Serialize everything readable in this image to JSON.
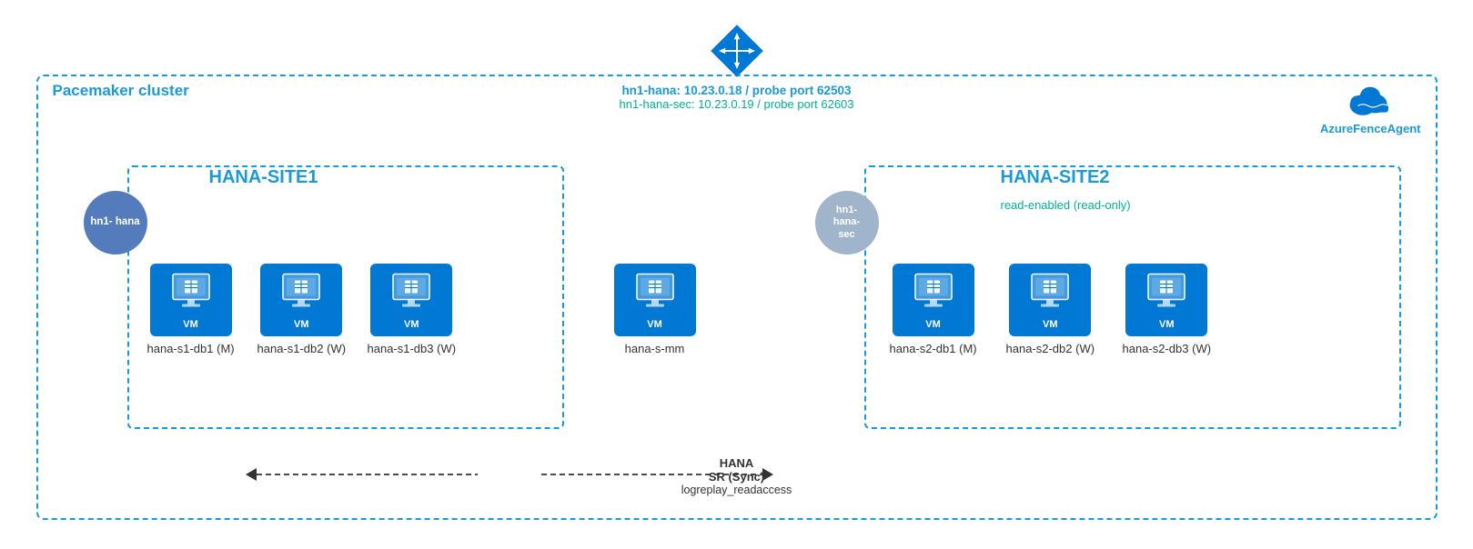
{
  "diagram": {
    "title": "Pacemaker cluster",
    "lb": {
      "label_primary": "hn1-hana:  10.23.0.18 / probe port 62503",
      "label_secondary": "hn1-hana-sec:  10.23.0.19 / probe port 62603"
    },
    "fence_agent": {
      "label": "AzureFenceAgent"
    },
    "circle_left": {
      "text": "hn1-\nhana"
    },
    "circle_right": {
      "text": "hn1-\nhana-\nsec"
    },
    "site1": {
      "label": "HANA-SITE1",
      "vms": [
        {
          "name": "hana-s1-db1 (M)"
        },
        {
          "name": "hana-s1-db2 (W)"
        },
        {
          "name": "hana-s1-db3 (W)"
        }
      ]
    },
    "site2": {
      "label": "HANA-SITE2",
      "read_label": "read-enabled (read-only)",
      "vms": [
        {
          "name": "hana-s2-db1 (M)"
        },
        {
          "name": "hana-s2-db2 (W)"
        },
        {
          "name": "hana-s2-db3 (W)"
        }
      ]
    },
    "middle_vm": {
      "name": "hana-s-mm"
    },
    "arrow": {
      "label": "HANA",
      "sublabel1": "SR (Sync)",
      "sublabel2": "logreplay_readaccess"
    },
    "vm_label": "VM"
  }
}
